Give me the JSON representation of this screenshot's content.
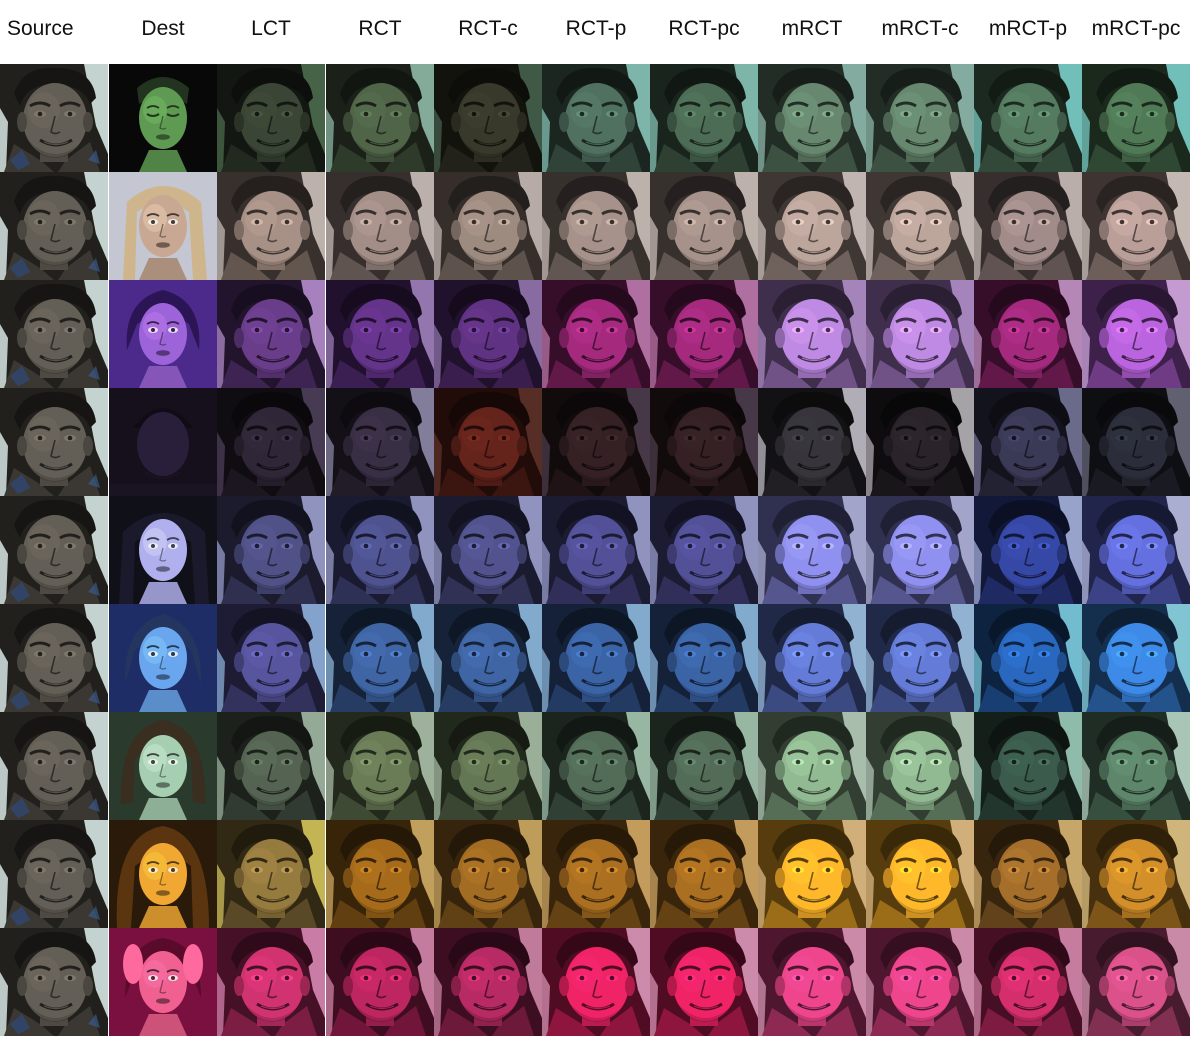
{
  "columns": [
    "Source",
    "Dest",
    "LCT",
    "RCT",
    "RCT-c",
    "RCT-p",
    "RCT-pc",
    "mRCT",
    "mRCT-c",
    "mRCT-p",
    "mRCT-pc"
  ],
  "rows": [
    {
      "dest": {
        "kind": "closed-eyes",
        "bg": "#080808",
        "skin": "#5f9a52",
        "hair": "#22331f"
      },
      "tints": [
        "#2b3327",
        "#3b4a35",
        "#2a2a20",
        "#3c5447",
        "#38503f",
        "#4c6552",
        "#4c6552",
        "#3e5a46",
        "#3b5a40"
      ],
      "glow": [
        "#5a7e5a",
        "#a8d8c6",
        "#50705a",
        "#9fe6d8",
        "#9fe6d8",
        "#a6d6c8",
        "#a6d6c8",
        "#8ff2ec",
        "#8ff2ec"
      ]
    },
    {
      "dest": {
        "kind": "blonde",
        "bg": "#c4c7d2",
        "skin": "#c9a893",
        "hair": "#cfb58c"
      },
      "tints": [
        "#7c6b63",
        "#786964",
        "#75675f",
        "#7b6c66",
        "#7b6c66",
        "#8b7a73",
        "#8b7a73",
        "#786866",
        "#8a7671"
      ],
      "glow": [
        "#e8dcd6",
        "#e8dcd6",
        "#e2d6d0",
        "#eadcd6",
        "#eadcd6",
        "#ece0da",
        "#ece0da",
        "#e6dad4",
        "#f0e4de"
      ]
    },
    {
      "dest": {
        "kind": "glam",
        "bg": "#4b2a8c",
        "skin": "#9c64d8",
        "hair": "#2c1555"
      },
      "tints": [
        "#4e2d66",
        "#4a2666",
        "#472561",
        "#7a1f5d",
        "#7a1f5d",
        "#8d66a9",
        "#8d66a9",
        "#7a1f5d",
        "#8a4aa5"
      ],
      "glow": [
        "#d3a6ee",
        "#b898d8",
        "#a98ac8",
        "#d890c8",
        "#d890c8",
        "#c7a2e0",
        "#c7a2e0",
        "#e0b0e6",
        "#f0c4ff"
      ]
    },
    {
      "dest": {
        "kind": "dark",
        "bg": "#15101c",
        "skin": "#2a1f3a",
        "hair": "#100c16"
      },
      "tints": [
        "#231c29",
        "#2a2333",
        "#4a1a14",
        "#27181b",
        "#27181b",
        "#29272c",
        "#1f1b1f",
        "#2b2a40",
        "#20222b"
      ],
      "glow": [
        "#5a4a6a",
        "#a8a2c8",
        "#6a3a30",
        "#58485a",
        "#58485a",
        "#e6e2ee",
        "#d8d4dc",
        "#8888b0",
        "#7c7c92"
      ]
    },
    {
      "dest": {
        "kind": "long-hair",
        "bg": "#101018",
        "skin": "#b0b0ee",
        "hair": "#1a1a2c"
      },
      "tints": [
        "#3b3c63",
        "#3a3d6a",
        "#3c3d69",
        "#3d3b70",
        "#3d3b70",
        "#6a6bb2",
        "#6a6bb2",
        "#28357a",
        "#4a53a6"
      ],
      "glow": [
        "#b8bcee",
        "#b8bcee",
        "#b8bcee",
        "#b8bcee",
        "#b8bcee",
        "#c8ccf2",
        "#c8ccf2",
        "#c6d2ff",
        "#d8ddff"
      ]
    },
    {
      "dest": {
        "kind": "blue-light",
        "bg": "#1f2d66",
        "skin": "#6aa6ee",
        "hair": "#243560"
      },
      "tints": [
        "#403f74",
        "#2f4b7a",
        "#2f4b7a",
        "#2c4a7c",
        "#2c4a7c",
        "#4a5ca0",
        "#4a5ca0",
        "#1f4d8e",
        "#2d66ac"
      ],
      "glow": [
        "#a6d0ff",
        "#a6d8ff",
        "#a6d8ff",
        "#a6d8ff",
        "#a6d8ff",
        "#b8e0ff",
        "#b8e0ff",
        "#96f0ff",
        "#a6f8ff"
      ]
    },
    {
      "dest": {
        "kind": "green-bob",
        "bg": "#2a3a2c",
        "skin": "#a6ceb0",
        "hair": "#3a2e20"
      },
      "tints": [
        "#3f4a3d",
        "#4e5c40",
        "#4a583e",
        "#3d5041",
        "#3d5041",
        "#6c8a6c",
        "#6c8a6c",
        "#2c4438",
        "#45634f"
      ],
      "glow": [
        "#bcd8c2",
        "#c8e0c6",
        "#c4dcc2",
        "#c2e8d0",
        "#c2e8d0",
        "#d0e8d4",
        "#d0e8d4",
        "#b8f0dc",
        "#d8f8e6"
      ]
    },
    {
      "dest": {
        "kind": "gold",
        "bg": "#2a1a0a",
        "skin": "#f0a832",
        "hair": "#5a3510"
      },
      "tints": [
        "#6f5b2f",
        "#7a4f14",
        "#78501a",
        "#7e5218",
        "#7e5218",
        "#c2881f",
        "#c2881f",
        "#7a5220",
        "#9c6a1e"
      ],
      "glow": [
        "#f6e46a",
        "#f0c878",
        "#ecc474",
        "#f2c47a",
        "#f2c47a",
        "#f8d6a0",
        "#f8d6a0",
        "#f8d28a",
        "#ffe2a0"
      ]
    },
    {
      "dest": {
        "kind": "pink",
        "bg": "#7a1040",
        "skin": "#f06090",
        "hair": "#5a0a2a"
      },
      "tints": [
        "#9b2654",
        "#8d1c48",
        "#881f49",
        "#b21a4c",
        "#b21a4c",
        "#b03368",
        "#b03368",
        "#9e2250",
        "#a23c66"
      ],
      "glow": [
        "#f6a0d0",
        "#f0a0c8",
        "#eca0c4",
        "#f6b6d8",
        "#f6b6d8",
        "#f4b2d2",
        "#f4b2d2",
        "#f0a2c8",
        "#f4b0d2"
      ]
    }
  ]
}
